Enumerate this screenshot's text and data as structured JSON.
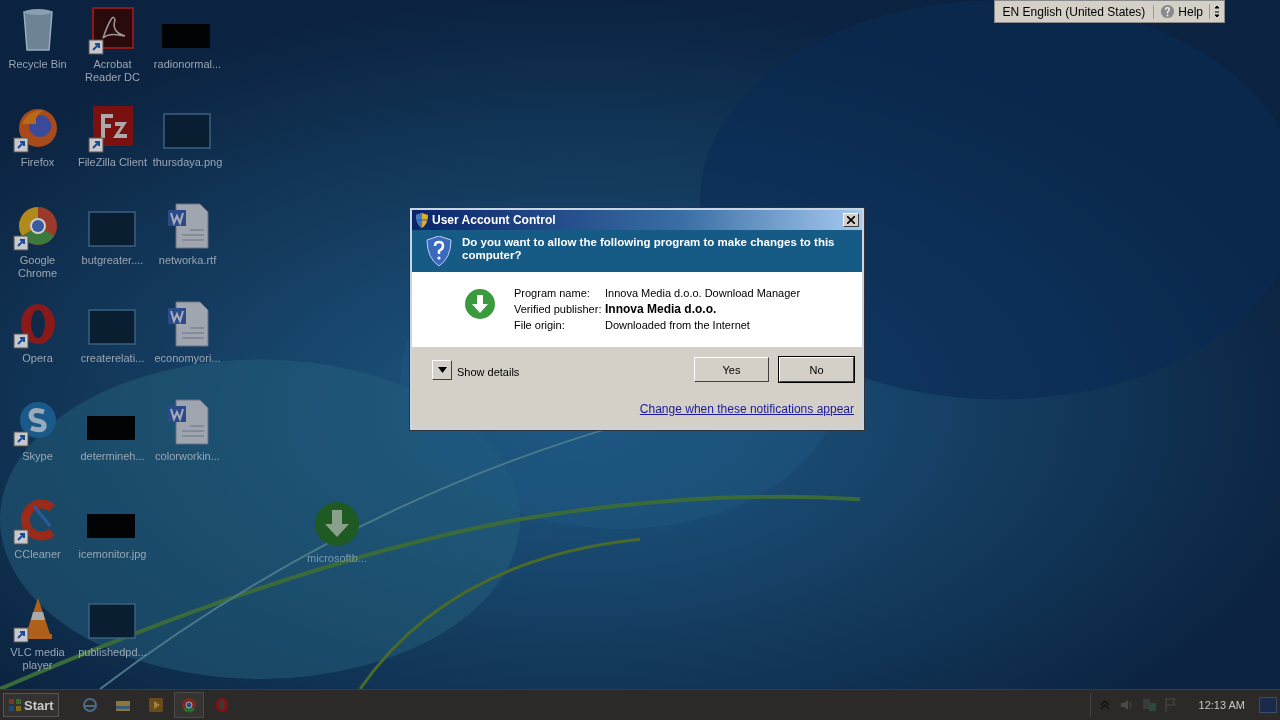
{
  "desktop": {
    "icons": [
      {
        "kind": "recycle",
        "label": "Recycle Bin",
        "shortcut": false
      },
      {
        "kind": "firefox",
        "label": "Firefox",
        "shortcut": true
      },
      {
        "kind": "chrome",
        "label": "Google Chrome",
        "shortcut": true
      },
      {
        "kind": "opera",
        "label": "Opera",
        "shortcut": true
      },
      {
        "kind": "skype",
        "label": "Skype",
        "shortcut": true
      },
      {
        "kind": "ccleaner",
        "label": "CCleaner",
        "shortcut": true
      },
      {
        "kind": "vlc",
        "label": "VLC media player",
        "shortcut": true
      },
      {
        "kind": "pdf",
        "label": "Acrobat Reader DC",
        "shortcut": true
      },
      {
        "kind": "filezilla",
        "label": "FileZilla Client",
        "shortcut": true
      },
      {
        "kind": "blank",
        "label": "butgreater....",
        "shortcut": false
      },
      {
        "kind": "blank",
        "label": "createrelati...",
        "shortcut": false
      },
      {
        "kind": "black",
        "label": "determineh...",
        "shortcut": false
      },
      {
        "kind": "black",
        "label": "icemonitor.jpg",
        "shortcut": false
      },
      {
        "kind": "blank",
        "label": "publishedpd...",
        "shortcut": false
      },
      {
        "kind": "black",
        "label": "radionormal...",
        "shortcut": false
      },
      {
        "kind": "blank",
        "label": "thursdaya.png",
        "shortcut": false
      },
      {
        "kind": "word",
        "label": "networka.rtf",
        "shortcut": false
      },
      {
        "kind": "word",
        "label": "economyori...",
        "shortcut": false
      },
      {
        "kind": "word",
        "label": "colorworkin...",
        "shortcut": false
      }
    ],
    "free_icons": [
      {
        "kind": "download",
        "label": "microsoftb..."
      }
    ]
  },
  "language_bar": {
    "language": "EN English (United States)",
    "help": "Help"
  },
  "dialog": {
    "title": "User Account Control",
    "question": "Do you want to allow the following program to make changes to this computer?",
    "details": [
      {
        "label": "Program name:",
        "value": "Innova Media d.o.o. Download Manager",
        "emphasis": false
      },
      {
        "label": "Verified publisher:",
        "value": "Innova Media d.o.o.",
        "emphasis": true
      },
      {
        "label": "File origin:",
        "value": "Downloaded from the Internet",
        "emphasis": false
      }
    ],
    "show_details": "Show details",
    "buttons": [
      "Yes",
      "No"
    ],
    "link": "Change when these notifications appear"
  },
  "taskbar": {
    "start": "Start",
    "apps": [
      {
        "kind": "ie",
        "active": false
      },
      {
        "kind": "explorer",
        "active": false
      },
      {
        "kind": "media",
        "active": false
      },
      {
        "kind": "chrome",
        "active": true
      },
      {
        "kind": "opera",
        "active": false
      }
    ],
    "clock": "12:13 AM"
  }
}
